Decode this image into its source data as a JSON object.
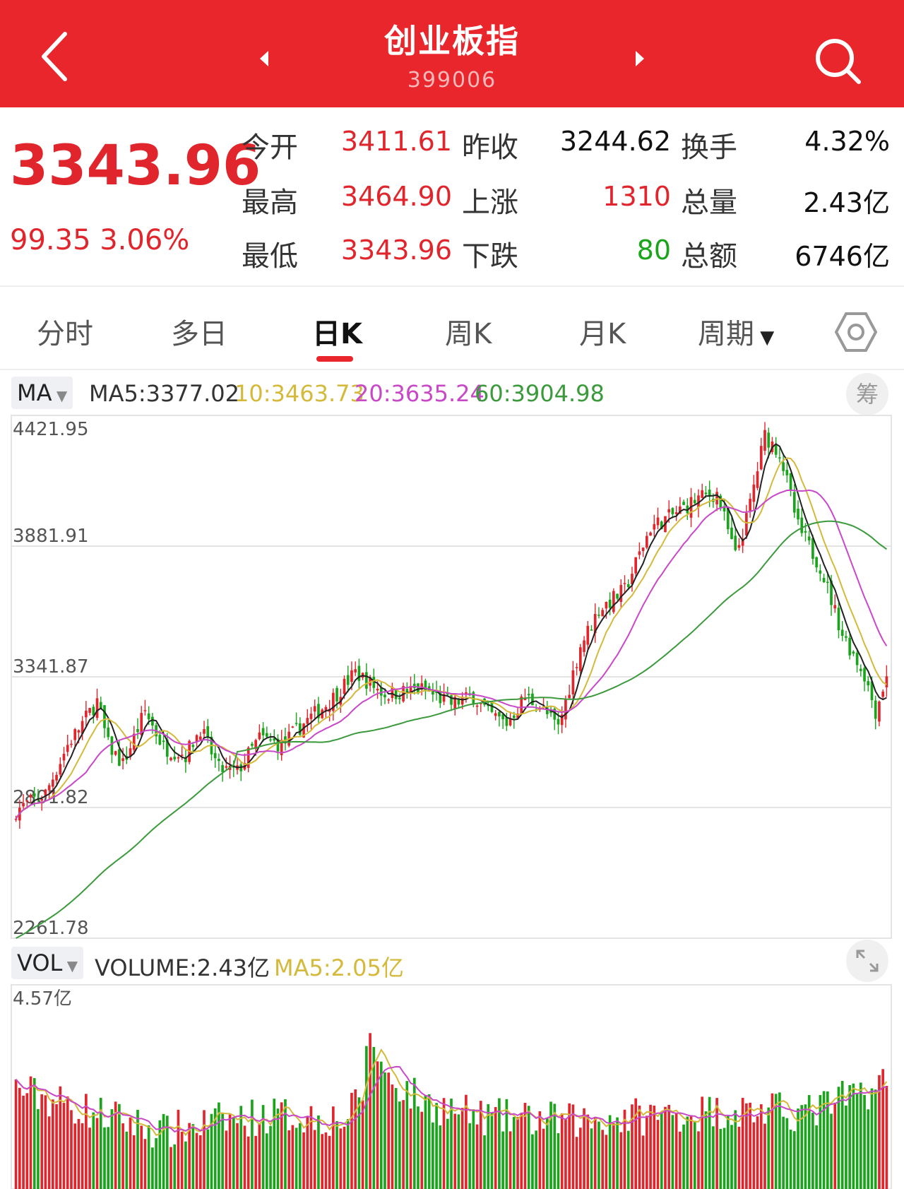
{
  "header": {
    "title": "创业板指",
    "code": "399006"
  },
  "quote": {
    "price": "3343.96",
    "change": "99.35 3.06%",
    "rows": [
      {
        "l1": "今开",
        "v1": "3411.61",
        "c1": "red",
        "l2": "昨收",
        "v2": "3244.62",
        "c2": "blk",
        "l3": "换手",
        "v3": "4.32%",
        "c3": "blk"
      },
      {
        "l1": "最高",
        "v1": "3464.90",
        "c1": "red",
        "l2": "上涨",
        "v2": "1310",
        "c2": "red",
        "l3": "总量",
        "v3": "2.43亿",
        "c3": "blk"
      },
      {
        "l1": "最低",
        "v1": "3343.96",
        "c1": "red",
        "l2": "下跌",
        "v2": "80",
        "c2": "green",
        "l3": "总额",
        "v3": "6746亿",
        "c3": "blk"
      }
    ]
  },
  "tabs": [
    "分时",
    "多日",
    "日K",
    "周K",
    "月K",
    "周期"
  ],
  "active_tab": "日K",
  "ma_legend": {
    "selector": "MA",
    "ma5": "MA5:3377.02",
    "ma10": "10:3463.73",
    "ma20": "20:3635.24",
    "ma60": "60:3904.98",
    "chip_button": "筹"
  },
  "vol_legend": {
    "selector": "VOL",
    "volume": "VOLUME:2.43亿",
    "ma5": "MA5:2.05亿"
  },
  "colors": {
    "up": "#e0262c",
    "down": "#19a41b",
    "ma5": "#222222",
    "ma10": "#d4b93a",
    "ma20": "#c848c8",
    "ma60": "#3b9a3b",
    "header": "#e8262c"
  },
  "chart_data": {
    "type": "candlestick",
    "y_ticks": [
      "4421.95",
      "3881.91",
      "3341.87",
      "2801.82",
      "2261.78"
    ],
    "ylim": [
      2261.78,
      4421.95
    ],
    "volume_max_label": "4.57亿",
    "ma_last": {
      "MA5": 3377.02,
      "MA10": 3463.73,
      "MA20": 3635.24,
      "MA60": 3904.98
    },
    "close_path": [
      [
        0,
        2790
      ],
      [
        8,
        2860
      ],
      [
        14,
        3060
      ],
      [
        22,
        3240
      ],
      [
        25,
        3060
      ],
      [
        29,
        2980
      ],
      [
        35,
        3200
      ],
      [
        40,
        3050
      ],
      [
        46,
        3020
      ],
      [
        50,
        3130
      ],
      [
        55,
        2960
      ],
      [
        60,
        2950
      ],
      [
        66,
        3090
      ],
      [
        72,
        3060
      ],
      [
        78,
        3150
      ],
      [
        85,
        3240
      ],
      [
        92,
        3360
      ],
      [
        100,
        3270
      ],
      [
        110,
        3290
      ],
      [
        118,
        3230
      ],
      [
        124,
        3260
      ],
      [
        128,
        3190
      ],
      [
        133,
        3150
      ],
      [
        138,
        3260
      ],
      [
        142,
        3220
      ],
      [
        147,
        3130
      ],
      [
        153,
        3470
      ],
      [
        158,
        3620
      ],
      [
        165,
        3700
      ],
      [
        172,
        3960
      ],
      [
        178,
        4010
      ],
      [
        185,
        4080
      ],
      [
        190,
        4100
      ],
      [
        195,
        3840
      ],
      [
        198,
        3990
      ],
      [
        203,
        4340
      ],
      [
        207,
        4270
      ],
      [
        212,
        3960
      ],
      [
        218,
        3800
      ],
      [
        224,
        3520
      ],
      [
        230,
        3350
      ],
      [
        233,
        3200
      ],
      [
        236,
        3344
      ]
    ],
    "volume_level_path": [
      [
        0,
        2.3
      ],
      [
        15,
        1.9
      ],
      [
        30,
        1.55
      ],
      [
        40,
        1.3
      ],
      [
        55,
        1.55
      ],
      [
        70,
        1.7
      ],
      [
        90,
        1.6
      ],
      [
        94,
        2.3
      ],
      [
        96,
        3.6
      ],
      [
        100,
        2.6
      ],
      [
        110,
        2.0
      ],
      [
        125,
        1.65
      ],
      [
        150,
        1.55
      ],
      [
        175,
        1.7
      ],
      [
        195,
        1.8
      ],
      [
        215,
        1.75
      ],
      [
        236,
        2.43
      ]
    ],
    "volume_ma5_last": 2.05
  }
}
